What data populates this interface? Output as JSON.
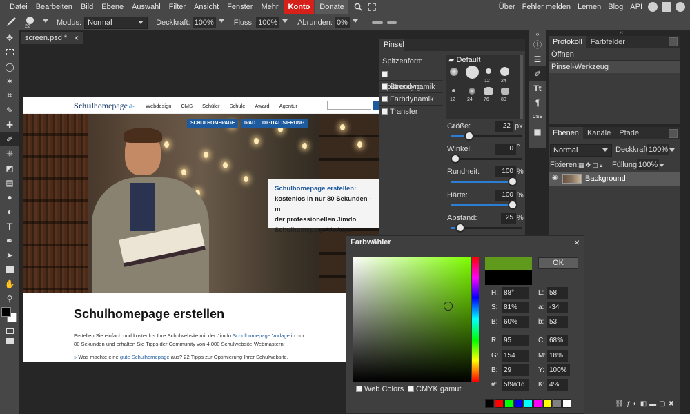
{
  "menubar": {
    "items": [
      "Datei",
      "Bearbeiten",
      "Bild",
      "Ebene",
      "Auswahl",
      "Filter",
      "Ansicht",
      "Fenster",
      "Mehr"
    ],
    "konto": "Konto",
    "donate": "Donate",
    "right_items": [
      "Über",
      "Fehler melden",
      "Lernen",
      "Blog",
      "API"
    ]
  },
  "options": {
    "brush_size": "22",
    "mode_label": "Modus:",
    "mode_value": "Normal",
    "opacity_label": "Deckkraft:",
    "opacity_value": "100%",
    "flow_label": "Fluss:",
    "flow_value": "100%",
    "round_label": "Abrunden:",
    "round_value": "0%"
  },
  "document": {
    "tab_label": "screen.psd *",
    "close": "×"
  },
  "website": {
    "logo_bold": "Schul",
    "logo_rest": "homepage",
    "logo_tld": ".de",
    "nav": [
      "Webdesign",
      "CMS",
      "Schüler",
      "Schule",
      "Award",
      "Agentur"
    ],
    "pills": [
      "SCHULHOMEPAGE",
      "IPAD",
      "DIGITALISIERUNG"
    ],
    "teaser_title": "Schulhomepage erstellen:",
    "teaser_lines": [
      "kostenlos in nur 80 Sekunden - m",
      "der professionellen Jimdo",
      "Schulhomepage-Vorlage."
    ],
    "heading": "Schulhomepage erstellen",
    "p1_a": "Erstellen Sie einfach und kostenlos Ihre Schulwebsite mit der Jimdo ",
    "p1_link": "Schulhomepage Vorlage",
    "p1_b": " in nur",
    "p2": "80 Sekunden und erhalten Sie Tipps der Community von 4.000 Schulwebsite-Webmastern:",
    "bullet_a": "Was machte eine ",
    "bullet_link": "gute Schulhomepage",
    "bullet_b": " aus? 22 Tipps zur Optimierung Ihrer Schulwebsite."
  },
  "brush_panel": {
    "title": "Pinsel",
    "tip_label": "Spitzenform",
    "options": [
      "Spitzendynamik",
      "Streuung",
      "Farbdynamik",
      "Transfer"
    ],
    "folder": "Default",
    "presets_row1": [
      "",
      "",
      "12",
      "24"
    ],
    "presets_row2": [
      "12",
      "24",
      "76",
      "80"
    ],
    "size_label": "Größe:",
    "size_value": "22",
    "size_unit": "px",
    "size_fraction": 0.22,
    "angle_label": "Winkel:",
    "angle_value": "0",
    "angle_unit": "°",
    "angle_fraction": 0,
    "round_label": "Rundheit:",
    "round_value": "100",
    "round_unit": "%",
    "round_fraction": 1,
    "hard_label": "Härte:",
    "hard_value": "100",
    "hard_unit": "%",
    "hard_fraction": 1,
    "spacing_label": "Abstand:",
    "spacing_value": "25",
    "spacing_unit": "%",
    "spacing_fraction": 0.08
  },
  "history_panel": {
    "tabs": [
      "Protokoll",
      "Farbfelder"
    ],
    "items": [
      "Öffnen",
      "Pinsel-Werkzeug"
    ]
  },
  "layers_panel": {
    "tabs": [
      "Ebenen",
      "Kanäle",
      "Pfade"
    ],
    "blend": "Normal",
    "opacity_label": "Deckkraft:",
    "opacity_value": "100%",
    "fix_label": "Fixieren:",
    "fill_label": "Füllung:",
    "fill_value": "100%",
    "layer_name": "Background"
  },
  "color_picker": {
    "title": "Farbwähler",
    "close": "×",
    "ok": "OK",
    "new_color": "#5f9a1d",
    "old_color": "#000000",
    "H_label": "H:",
    "H": "88°",
    "S_label": "S:",
    "S": "81%",
    "B_label": "B:",
    "B": "60%",
    "L_label": "L:",
    "L": "58",
    "a_label": "a:",
    "a": "-34",
    "b_label": "b:",
    "b": "53",
    "R_label": "R:",
    "R": "95",
    "G_label": "G:",
    "G": "154",
    "Bl_label": "B:",
    "Bl": "29",
    "C_label": "C:",
    "C": "68%",
    "M_label": "M:",
    "M": "18%",
    "Y_label": "Y:",
    "Y": "100%",
    "K_label": "K:",
    "K": "4%",
    "hex_label": "#:",
    "hex": "5f9a1d",
    "web_colors": "Web Colors",
    "cmyk_gamut": "CMYK gamut",
    "swatches": [
      "#000000",
      "#ff0000",
      "#00ff00",
      "#0000ff",
      "#00ffff",
      "#ff00ff",
      "#ffff00",
      "#808080",
      "#ffffff"
    ]
  },
  "colors": {
    "accent": "#2a7fd4",
    "konto": "#d6201a",
    "link": "#1e5a9e"
  }
}
